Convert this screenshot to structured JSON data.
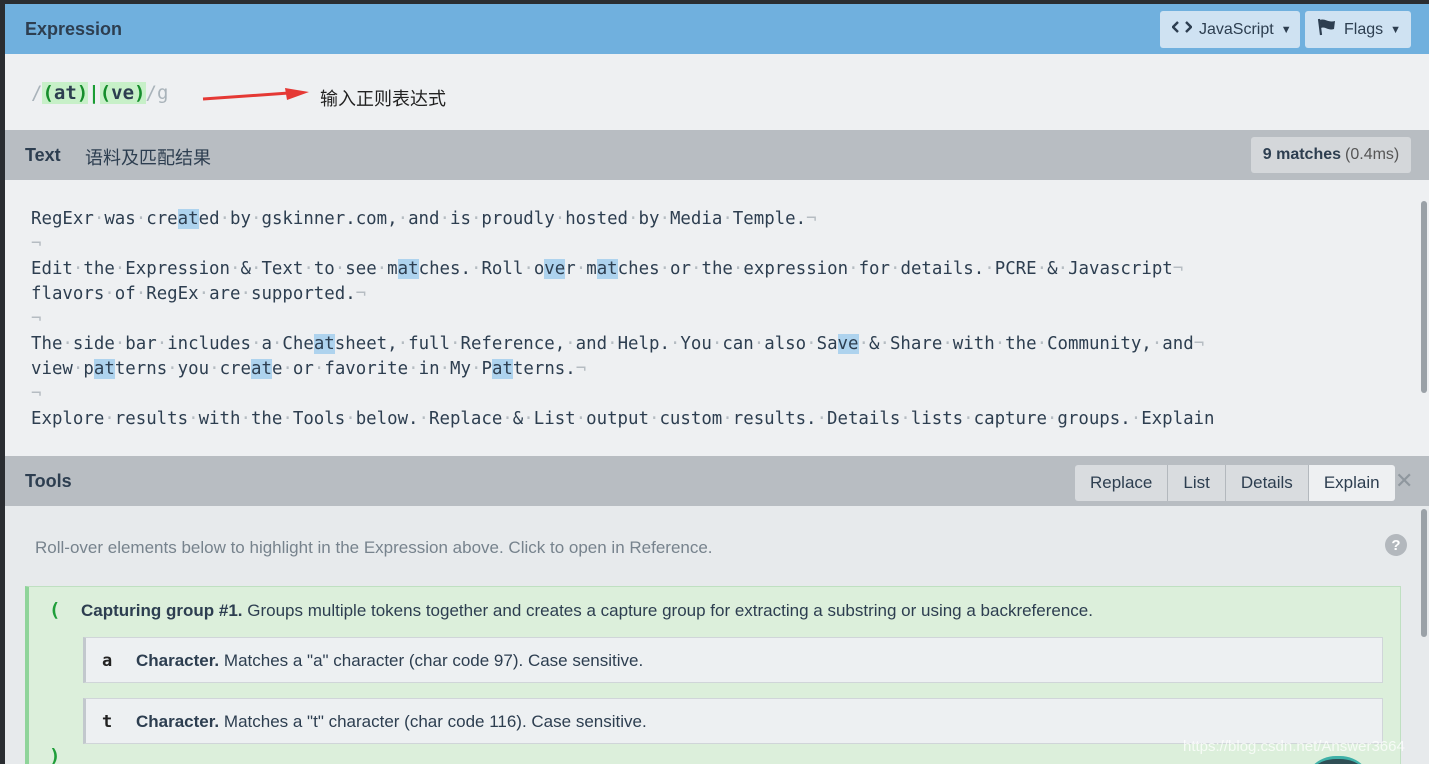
{
  "header": {
    "title": "Expression",
    "flavor_label": "JavaScript",
    "flags_label": "Flags"
  },
  "expression": {
    "open_delim": "/",
    "group1_open": "(",
    "group1_text": "at",
    "group1_close": ")",
    "alternation": "|",
    "group2_open": "(",
    "group2_text": "ve",
    "group2_close": ")",
    "close_delim": "/",
    "flags": "g",
    "annotation": "输入正则表达式"
  },
  "text_section": {
    "title": "Text",
    "annotation": "语料及匹配结果",
    "match_count": "9 matches",
    "match_time": "(0.4ms)"
  },
  "corpus_lines": [
    "RegExr was created by gskinner.com, and is proudly hosted by Media Temple.",
    "",
    "Edit the Expression & Text to see matches. Roll over matches or the expression for details. PCRE & Javascript",
    "flavors of RegEx are supported.",
    "",
    "The side bar includes a Cheatsheet, full Reference, and Help. You can also Save & Share with the Community, and",
    "view patterns you create or favorite in My Patterns.",
    "",
    "Explore results with the Tools below. Replace & List output custom results. Details lists capture groups. Explain"
  ],
  "tools": {
    "title": "Tools",
    "tabs": [
      "Replace",
      "List",
      "Details",
      "Explain"
    ],
    "active_tab": "Explain",
    "hint": "Roll-over elements below to highlight in the Expression above. Click to open in Reference.",
    "group": {
      "open_paren": "(",
      "close_paren": ")",
      "title": "Capturing group #1.",
      "description": "Groups multiple tokens together and creates a capture group for extracting a substring or using a backreference."
    },
    "characters": [
      {
        "glyph": "a",
        "title": "Character.",
        "description": "Matches a \"a\" character (char code 97). Case sensitive."
      },
      {
        "glyph": "t",
        "title": "Character.",
        "description": "Matches a \"t\" character (char code 116). Case sensitive."
      }
    ]
  },
  "watermark": "https://blog.csdn.net/Answer3664",
  "colors": {
    "header_blue": "#70b0de",
    "section_gray": "#b8bdc2",
    "match_highlight": "#aed3ee",
    "group_green": "#dcefdb"
  },
  "icons": {
    "flavor": "code-brackets-icon",
    "flags": "flag-icon",
    "close": "close-icon",
    "help": "question-icon"
  }
}
